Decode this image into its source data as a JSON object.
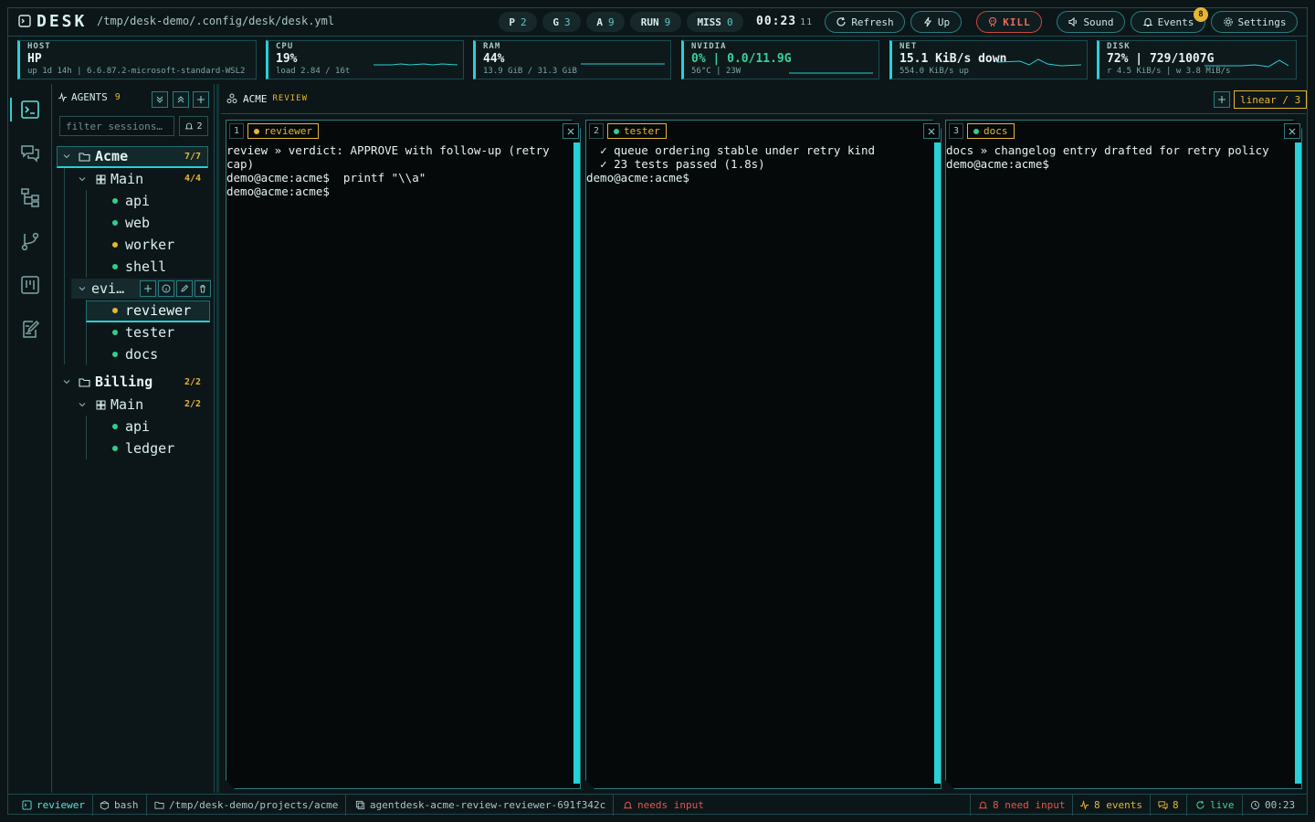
{
  "app": {
    "name": "DESK",
    "config_path": "/tmp/desk-demo/.config/desk/desk.yml"
  },
  "counters": [
    {
      "key": "P",
      "value": "2"
    },
    {
      "key": "G",
      "value": "3"
    },
    {
      "key": "A",
      "value": "9"
    },
    {
      "key": "RUN",
      "value": "9"
    },
    {
      "key": "MISS",
      "value": "0"
    }
  ],
  "timer": {
    "main": "00:23",
    "sub": "11"
  },
  "toolbar": {
    "refresh": "Refresh",
    "up": "Up",
    "kill": "KILL",
    "sound": "Sound",
    "events": "Events",
    "events_badge": "8",
    "settings": "Settings"
  },
  "metrics": {
    "host": {
      "label": "HOST",
      "value": "HP",
      "sub": "up 1d 14h | 6.6.87.2-microsoft-standard-WSL2"
    },
    "cpu": {
      "label": "CPU",
      "value": "19%",
      "sub": "load 2.84 / 16t"
    },
    "ram": {
      "label": "RAM",
      "value": "44%",
      "sub": "13.9 GiB / 31.3 GiB"
    },
    "gpu": {
      "label": "NVIDIA",
      "value": "0% | 0.0/11.9G",
      "sub": "56°C | 23W"
    },
    "net": {
      "label": "NET",
      "value": "15.1 KiB/s down",
      "sub": "554.0 KiB/s up"
    },
    "disk": {
      "label": "DISK",
      "value": "72% | 729/1007G",
      "sub": "r 4.5 KiB/s | w 3.8 MiB/s"
    }
  },
  "agents": {
    "title": "AGENTS",
    "count": "9",
    "filter_placeholder": "filter sessions…",
    "bell_count": "2",
    "orgs": [
      {
        "name": "Acme",
        "count": "7/7",
        "groups": [
          {
            "name": "Main",
            "count": "4/4",
            "sessions": [
              "api",
              "web",
              "worker",
              "shell"
            ]
          },
          {
            "name": "Review",
            "short": "evi…",
            "sessions": [
              "reviewer",
              "tester",
              "docs"
            ]
          }
        ]
      },
      {
        "name": "Billing",
        "count": "2/2",
        "groups": [
          {
            "name": "Main",
            "count": "2/2",
            "sessions": [
              "api",
              "ledger"
            ]
          }
        ]
      }
    ]
  },
  "workspace": {
    "org": "ACME",
    "mode": "REVIEW",
    "layout": "linear / 3",
    "panes": [
      {
        "num": "1",
        "name": "reviewer",
        "lines": "review » verdict: APPROVE with follow-up (retry cap)\ndemo@acme:acme$  printf \"\\\\a\"\ndemo@acme:acme$ "
      },
      {
        "num": "2",
        "name": "tester",
        "lines": "  ✓ queue ordering stable under retry kind\n  ✓ 23 tests passed (1.8s)\ndemo@acme:acme$ "
      },
      {
        "num": "3",
        "name": "docs",
        "lines": "docs » changelog entry drafted for retry policy\ndemo@acme:acme$ "
      }
    ]
  },
  "statusbar": {
    "session": "reviewer",
    "shell": "bash",
    "cwd": "/tmp/desk-demo/projects/acme",
    "tmux": "agentdesk-acme-review-reviewer-691f342c",
    "state": "needs input",
    "need_input": "8 need input",
    "events": "8 events",
    "messages": "8",
    "live": "live",
    "clock": "00:23"
  },
  "colors": {
    "accent": "#27d1d6",
    "warning": "#e7b534",
    "danger": "#e0574a",
    "ok": "#2fcf8f"
  }
}
